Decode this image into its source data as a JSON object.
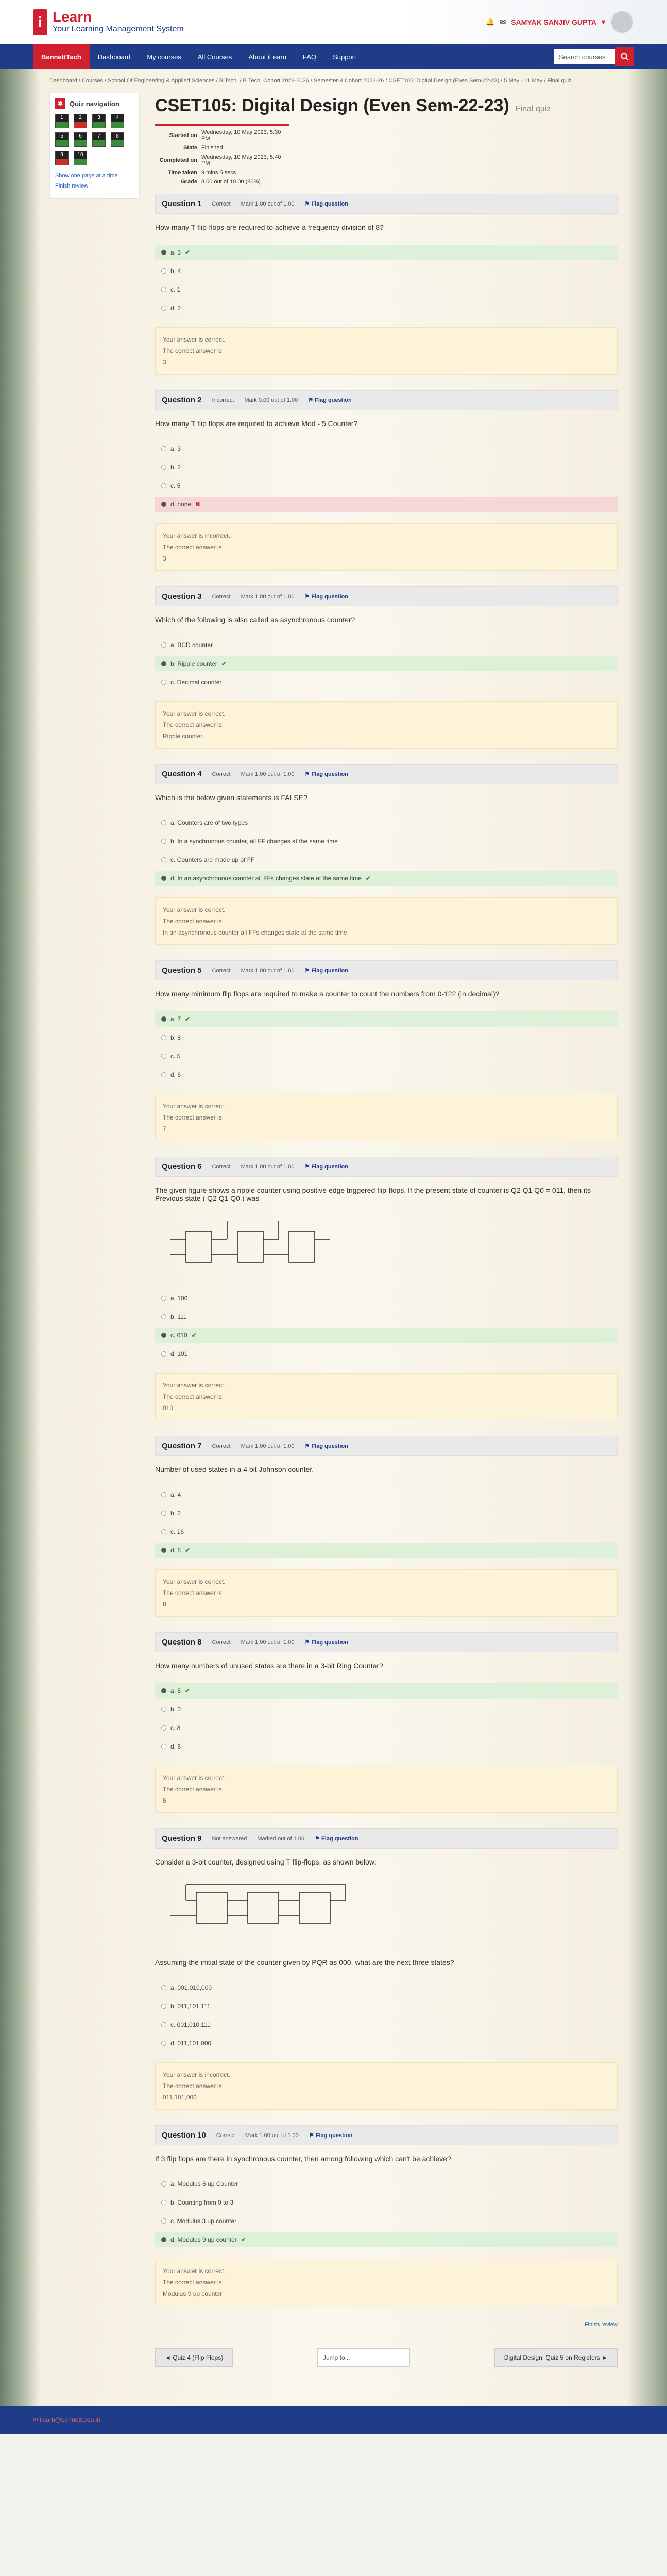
{
  "header": {
    "logo_letter": "i",
    "logo_line1": "Learn",
    "logo_line2": "Your Learning Management System",
    "user_name": "SAMYAK SANJIV GUPTA"
  },
  "nav": {
    "brand": "BennettTech",
    "items": [
      "Dashboard",
      "My courses",
      "All Courses",
      "About iLearn",
      "FAQ",
      "Support"
    ],
    "search_label": "Search courses"
  },
  "breadcrumb": "Dashboard / Courses / School Of Engineering & Applied Sciences / B.Tech. / B.Tech. Cohort 2022-2026 / Semester-4 Cohort 2022-26 / CSET105: Digital Design (Even Sem-22-23) / 5 May - 11 May / Final quiz",
  "quiz_nav": {
    "title": "Quiz navigation",
    "buttons": [
      {
        "label": "1",
        "status": "correct"
      },
      {
        "label": "2",
        "status": "wrong"
      },
      {
        "label": "3",
        "status": "correct"
      },
      {
        "label": "4",
        "status": "correct"
      },
      {
        "label": "5",
        "status": "correct"
      },
      {
        "label": "6",
        "status": "correct"
      },
      {
        "label": "7",
        "status": "correct"
      },
      {
        "label": "8",
        "status": "correct"
      },
      {
        "label": "9",
        "status": "wrong"
      },
      {
        "label": "10",
        "status": "correct"
      }
    ],
    "show_one_page": "Show one page at a time",
    "finish_review": "Finish review"
  },
  "page": {
    "title": "CSET105: Digital Design (Even Sem-22-23)",
    "subtitle": "Final quiz"
  },
  "summary": [
    {
      "k": "Started on",
      "v": "Wednesday, 10 May 2023, 5:30 PM"
    },
    {
      "k": "State",
      "v": "Finished"
    },
    {
      "k": "Completed on",
      "v": "Wednesday, 10 May 2023, 5:40 PM"
    },
    {
      "k": "Time taken",
      "v": "9 mins 5 secs"
    },
    {
      "k": "Grade",
      "v": "8.00 out of 10.00 (80%)"
    }
  ],
  "flag_label": "Flag question",
  "questions": [
    {
      "no": "Question 1",
      "state": "Correct",
      "mark": "Mark 1.00 out of 1.00",
      "text": "How many T flip-flops are required to achieve a frequency division of 8?",
      "options": [
        {
          "t": "a. 3",
          "cls": "sel good",
          "mk": "✔"
        },
        {
          "t": "b. 4",
          "cls": "",
          "mk": ""
        },
        {
          "t": "c. 1",
          "cls": "",
          "mk": ""
        },
        {
          "t": "d. 2",
          "cls": "",
          "mk": ""
        }
      ],
      "fb1": "Your answer is correct.",
      "fb2": "The correct answer is:",
      "fb3": "3"
    },
    {
      "no": "Question 2",
      "state": "Incorrect",
      "mark": "Mark 0.00 out of 1.00",
      "text": "How many T flip flops are required to achieve Mod - 5 Counter?",
      "options": [
        {
          "t": "a. 3",
          "cls": "",
          "mk": ""
        },
        {
          "t": "b. 2",
          "cls": "",
          "mk": ""
        },
        {
          "t": "c. 5",
          "cls": "",
          "mk": ""
        },
        {
          "t": "d. none",
          "cls": "sel bad",
          "mk": "✖"
        }
      ],
      "fb1": "Your answer is incorrect.",
      "fb2": "The correct answer is:",
      "fb3": "3"
    },
    {
      "no": "Question 3",
      "state": "Correct",
      "mark": "Mark 1.00 out of 1.00",
      "text": "Which of the following is also called as asynchronous counter?",
      "options": [
        {
          "t": "a. BCD counter",
          "cls": "",
          "mk": ""
        },
        {
          "t": "b. Ripple counter",
          "cls": "sel good",
          "mk": "✔"
        },
        {
          "t": "c. Decimal counter",
          "cls": "",
          "mk": ""
        }
      ],
      "fb1": "Your answer is correct.",
      "fb2": "The correct answer is:",
      "fb3": "Ripple counter"
    },
    {
      "no": "Question 4",
      "state": "Correct",
      "mark": "Mark 1.00 out of 1.00",
      "text": "Which is the below given statements is FALSE?",
      "options": [
        {
          "t": "a. Counters are of two types",
          "cls": "",
          "mk": ""
        },
        {
          "t": "b. In a synchronous counter, all FF changes at the same time",
          "cls": "",
          "mk": ""
        },
        {
          "t": "c. Counters are made up of FF",
          "cls": "",
          "mk": ""
        },
        {
          "t": "d. In an asynchronous counter all FFs changes state at the same time",
          "cls": "sel good",
          "mk": "✔"
        }
      ],
      "fb1": "Your answer is correct.",
      "fb2": "The correct answer is:",
      "fb3": "In an asynchronous counter all FFs changes state at the same time"
    },
    {
      "no": "Question 5",
      "state": "Correct",
      "mark": "Mark 1.00 out of 1.00",
      "text": "How many minimum flip flops are required to make a counter to count the numbers from 0-122 (in decimal)?",
      "options": [
        {
          "t": "a. 7",
          "cls": "sel good",
          "mk": "✔"
        },
        {
          "t": "b. 8",
          "cls": "",
          "mk": ""
        },
        {
          "t": "c. 5",
          "cls": "",
          "mk": ""
        },
        {
          "t": "d. 6",
          "cls": "",
          "mk": ""
        }
      ],
      "fb1": "Your answer is correct.",
      "fb2": "The correct answer is:",
      "fb3": "7"
    },
    {
      "no": "Question 6",
      "state": "Correct",
      "mark": "Mark 1.00 out of 1.00",
      "text": "The given figure shows a ripple counter using positive edge triggered flip-flops. If the present state of counter is Q2 Q1 Q0 = 011, then its Previous state ( Q2 Q1 Q0 ) was _______",
      "circuit": "ripple",
      "options": [
        {
          "t": "a. 100",
          "cls": "",
          "mk": ""
        },
        {
          "t": "b. 111",
          "cls": "",
          "mk": ""
        },
        {
          "t": "c. 010",
          "cls": "sel good",
          "mk": "✔"
        },
        {
          "t": "d. 101",
          "cls": "",
          "mk": ""
        }
      ],
      "fb1": "Your answer is correct.",
      "fb2": "The correct answer is:",
      "fb3": "010"
    },
    {
      "no": "Question 7",
      "state": "Correct",
      "mark": "Mark 1.00 out of 1.00",
      "text": "Number of used states in a 4 bit Johnson counter.",
      "options": [
        {
          "t": "a. 4",
          "cls": "",
          "mk": ""
        },
        {
          "t": "b. 2",
          "cls": "",
          "mk": ""
        },
        {
          "t": "c. 16",
          "cls": "",
          "mk": ""
        },
        {
          "t": "d. 8",
          "cls": "sel good",
          "mk": "✔"
        }
      ],
      "fb1": "Your answer is correct.",
      "fb2": "The correct answer is:",
      "fb3": "8"
    },
    {
      "no": "Question 8",
      "state": "Correct",
      "mark": "Mark 1.00 out of 1.00",
      "text": "How many numbers of unused states are there in a 3-bit Ring Counter?",
      "options": [
        {
          "t": "a. 5",
          "cls": "sel good",
          "mk": "✔"
        },
        {
          "t": "b. 3",
          "cls": "",
          "mk": ""
        },
        {
          "t": "c. 8",
          "cls": "",
          "mk": ""
        },
        {
          "t": "d. 6",
          "cls": "",
          "mk": ""
        }
      ],
      "fb1": "Your answer is correct.",
      "fb2": "The correct answer is:",
      "fb3": "5"
    },
    {
      "no": "Question 9",
      "state": "Not answered",
      "mark": "Marked out of 1.00",
      "text": "Consider a 3-bit counter, designed using T flip-flops, as shown below:",
      "circuit": "tff",
      "text2": "Assuming the initial state of the counter given by PQR as 000, what are the next three states?",
      "options": [
        {
          "t": "a. 001,010,000",
          "cls": "",
          "mk": ""
        },
        {
          "t": "b. 011,101,111",
          "cls": "",
          "mk": ""
        },
        {
          "t": "c. 001,010,111",
          "cls": "",
          "mk": ""
        },
        {
          "t": "d. 011,101,000",
          "cls": "",
          "mk": ""
        }
      ],
      "fb1": "Your answer is incorrect.",
      "fb2": "The correct answer is:",
      "fb3": "011,101,000"
    },
    {
      "no": "Question 10",
      "state": "Correct",
      "mark": "Mark 1.00 out of 1.00",
      "text": "If 3 flip flops are there in synchronous counter, then among following which can't be achieve?",
      "options": [
        {
          "t": "a. Modulus 6 up Counter",
          "cls": "",
          "mk": ""
        },
        {
          "t": "b. Counting from 0 to 3",
          "cls": "",
          "mk": ""
        },
        {
          "t": "c. Modulus 3 up counter",
          "cls": "",
          "mk": ""
        },
        {
          "t": "d. Modulus 9 up counter",
          "cls": "sel good",
          "mk": "✔"
        }
      ],
      "fb1": "Your answer is correct.",
      "fb2": "The correct answer is:",
      "fb3": "Modulus 9 up counter"
    }
  ],
  "finish_review": "Finish review",
  "bottom": {
    "prev": "◄ Quiz 4 (Flip Flops)",
    "jump": "Jump to...",
    "next": "Digital Design: Quiz 5 on Registers ►"
  },
  "footer": "ilearn@bennett.edu.in"
}
